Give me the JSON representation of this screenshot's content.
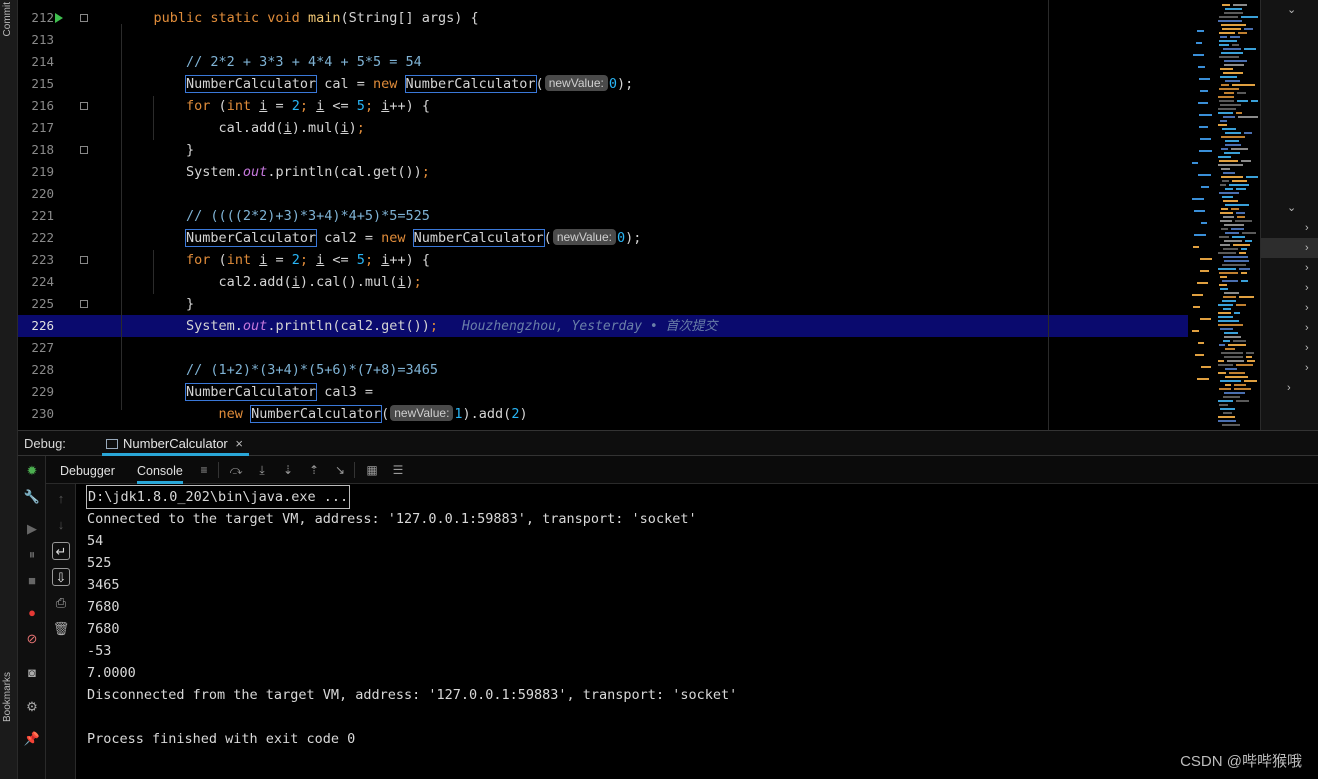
{
  "left_strip": {
    "top_label": "Commit",
    "bottom_label": "Bookmarks"
  },
  "editor": {
    "current_line": 226,
    "blame_text": "Houzhengzhou, Yesterday • 首次提交",
    "lines": [
      {
        "num": "212",
        "tokens": [
          [
            "",
            "    "
          ],
          [
            "kw",
            "public static void "
          ],
          [
            "fn",
            "main"
          ],
          [
            "",
            "(String[] args) {"
          ]
        ]
      },
      {
        "num": "213",
        "tokens": []
      },
      {
        "num": "214",
        "tokens": [
          [
            "",
            "        "
          ],
          [
            "cm",
            "// 2*2 + 3*3 + 4*4 + 5*5 = 54"
          ]
        ]
      },
      {
        "num": "215",
        "tokens": [
          [
            "",
            "        "
          ],
          [
            "boxed",
            "NumberCalculator"
          ],
          [
            "",
            " cal = "
          ],
          [
            "kw",
            "new "
          ],
          [
            "boxed",
            "NumberCalculator"
          ],
          [
            "",
            "("
          ],
          [
            "hint",
            "newValue:"
          ],
          [
            "num",
            "0"
          ],
          [
            "",
            ");"
          ]
        ]
      },
      {
        "num": "216",
        "tokens": [
          [
            "",
            "        "
          ],
          [
            "kw",
            "for "
          ],
          [
            "",
            "("
          ],
          [
            "kw",
            "int "
          ],
          [
            "ul",
            "i"
          ],
          [
            "",
            " = "
          ],
          [
            "num",
            "2"
          ],
          [
            "kw",
            "; "
          ],
          [
            "ul",
            "i"
          ],
          [
            "",
            " <= "
          ],
          [
            "num",
            "5"
          ],
          [
            "kw",
            "; "
          ],
          [
            "ul",
            "i"
          ],
          [
            "",
            "++) {"
          ]
        ]
      },
      {
        "num": "217",
        "tokens": [
          [
            "",
            "            cal.add("
          ],
          [
            "ul",
            "i"
          ],
          [
            "",
            ").mul("
          ],
          [
            "ul",
            "i"
          ],
          [
            "",
            ")"
          ],
          [
            "kw",
            ";"
          ]
        ]
      },
      {
        "num": "218",
        "tokens": [
          [
            "",
            "        }"
          ]
        ]
      },
      {
        "num": "219",
        "tokens": [
          [
            "",
            "        System."
          ],
          [
            "st",
            "out"
          ],
          [
            "",
            ".println(cal.get())"
          ],
          [
            "kw",
            ";"
          ]
        ]
      },
      {
        "num": "220",
        "tokens": []
      },
      {
        "num": "221",
        "tokens": [
          [
            "",
            "        "
          ],
          [
            "cm",
            "// ((((2*2)+3)*3+4)*4+5)*5=525"
          ]
        ]
      },
      {
        "num": "222",
        "tokens": [
          [
            "",
            "        "
          ],
          [
            "boxed",
            "NumberCalculator"
          ],
          [
            "",
            " cal2 = "
          ],
          [
            "kw",
            "new "
          ],
          [
            "boxed",
            "NumberCalculator"
          ],
          [
            "",
            "("
          ],
          [
            "hint",
            "newValue:"
          ],
          [
            "num",
            "0"
          ],
          [
            "",
            ");"
          ]
        ]
      },
      {
        "num": "223",
        "tokens": [
          [
            "",
            "        "
          ],
          [
            "kw",
            "for "
          ],
          [
            "",
            "("
          ],
          [
            "kw",
            "int "
          ],
          [
            "ul",
            "i"
          ],
          [
            "",
            " = "
          ],
          [
            "num",
            "2"
          ],
          [
            "kw",
            "; "
          ],
          [
            "ul",
            "i"
          ],
          [
            "",
            " <= "
          ],
          [
            "num",
            "5"
          ],
          [
            "kw",
            "; "
          ],
          [
            "ul",
            "i"
          ],
          [
            "",
            "++) {"
          ]
        ]
      },
      {
        "num": "224",
        "tokens": [
          [
            "",
            "            cal2.add("
          ],
          [
            "ul",
            "i"
          ],
          [
            "",
            ").cal().mul("
          ],
          [
            "ul",
            "i"
          ],
          [
            "",
            ")"
          ],
          [
            "kw",
            ";"
          ]
        ]
      },
      {
        "num": "225",
        "tokens": [
          [
            "",
            "        }"
          ]
        ]
      },
      {
        "num": "226",
        "tokens": [
          [
            "",
            "        System."
          ],
          [
            "st",
            "out"
          ],
          [
            "",
            ".println(cal2.get())"
          ],
          [
            "kw",
            ";"
          ]
        ]
      },
      {
        "num": "227",
        "tokens": []
      },
      {
        "num": "228",
        "tokens": [
          [
            "",
            "        "
          ],
          [
            "cm",
            "// (1+2)*(3+4)*(5+6)*(7+8)=3465"
          ]
        ]
      },
      {
        "num": "229",
        "tokens": [
          [
            "",
            "        "
          ],
          [
            "boxed",
            "NumberCalculator"
          ],
          [
            "",
            " cal3 ="
          ]
        ]
      },
      {
        "num": "230",
        "tokens": [
          [
            "",
            "            "
          ],
          [
            "kw",
            "new "
          ],
          [
            "boxed",
            "NumberCalculator"
          ],
          [
            "",
            "("
          ],
          [
            "hint",
            "newValue:"
          ],
          [
            "num",
            "1"
          ],
          [
            "",
            ").add("
          ],
          [
            "num",
            "2"
          ],
          [
            "",
            ")"
          ]
        ]
      }
    ]
  },
  "debug": {
    "title": "Debug:",
    "tab_label": "NumberCalculator",
    "tab_close": "×",
    "tabs": [
      "Debugger",
      "Console"
    ],
    "active_tab": "Console"
  },
  "console": {
    "lines": [
      "D:\\jdk1.8.0_202\\bin\\java.exe ...",
      "Connected to the target VM, address: '127.0.0.1:59883', transport: 'socket'",
      "54",
      "525",
      "3465",
      "7680",
      "7680",
      "-53",
      "7.0000",
      "Disconnected from the target VM, address: '127.0.0.1:59883', transport: 'socket'",
      "",
      "Process finished with exit code 0"
    ]
  },
  "watermark": "CSDN @哔哔猴哦",
  "colors": {
    "keyword": "#e08c3a",
    "number": "#29b6f6",
    "comment": "#7fb3d5",
    "current_line": "#0a0a6e",
    "accent": "#2aa7d8",
    "run_arrow": "#3fbf4f"
  }
}
